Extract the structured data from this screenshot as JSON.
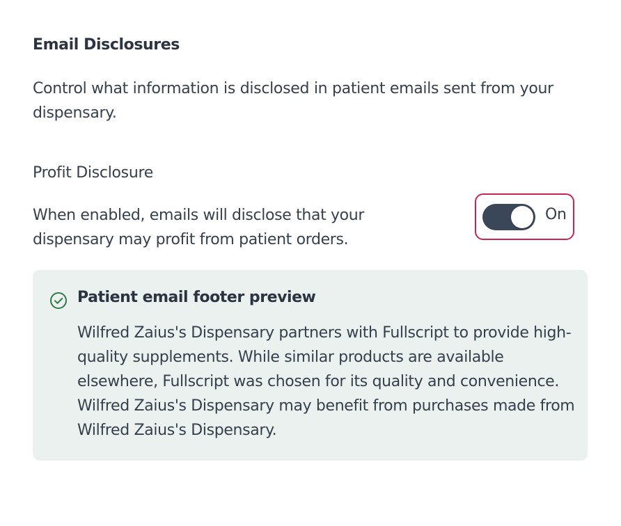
{
  "section": {
    "title": "Email Disclosures",
    "description": "Control what information is disclosed in patient emails sent from your dispensary."
  },
  "setting": {
    "title": "Profit Disclosure",
    "description": "When enabled, emails will disclose that your dispensary may profit from patient orders.",
    "toggle": {
      "state": true,
      "label": "On"
    }
  },
  "preview": {
    "icon": "check-circle-icon",
    "title": "Patient email footer preview",
    "text": "Wilfred Zaius's Dispensary partners with Fullscript to provide high-quality supplements. While similar products are available elsewhere, Fullscript was chosen for its quality and convenience. Wilfred Zaius's Dispensary may benefit from purchases made from Wilfred Zaius's Dispensary."
  },
  "colors": {
    "text": "#36404d",
    "heading": "#2b3440",
    "toggle_track": "#3a4758",
    "focus_ring": "#c8254f",
    "preview_bg": "#ebf1ee",
    "check_icon": "#2f7a4a"
  }
}
